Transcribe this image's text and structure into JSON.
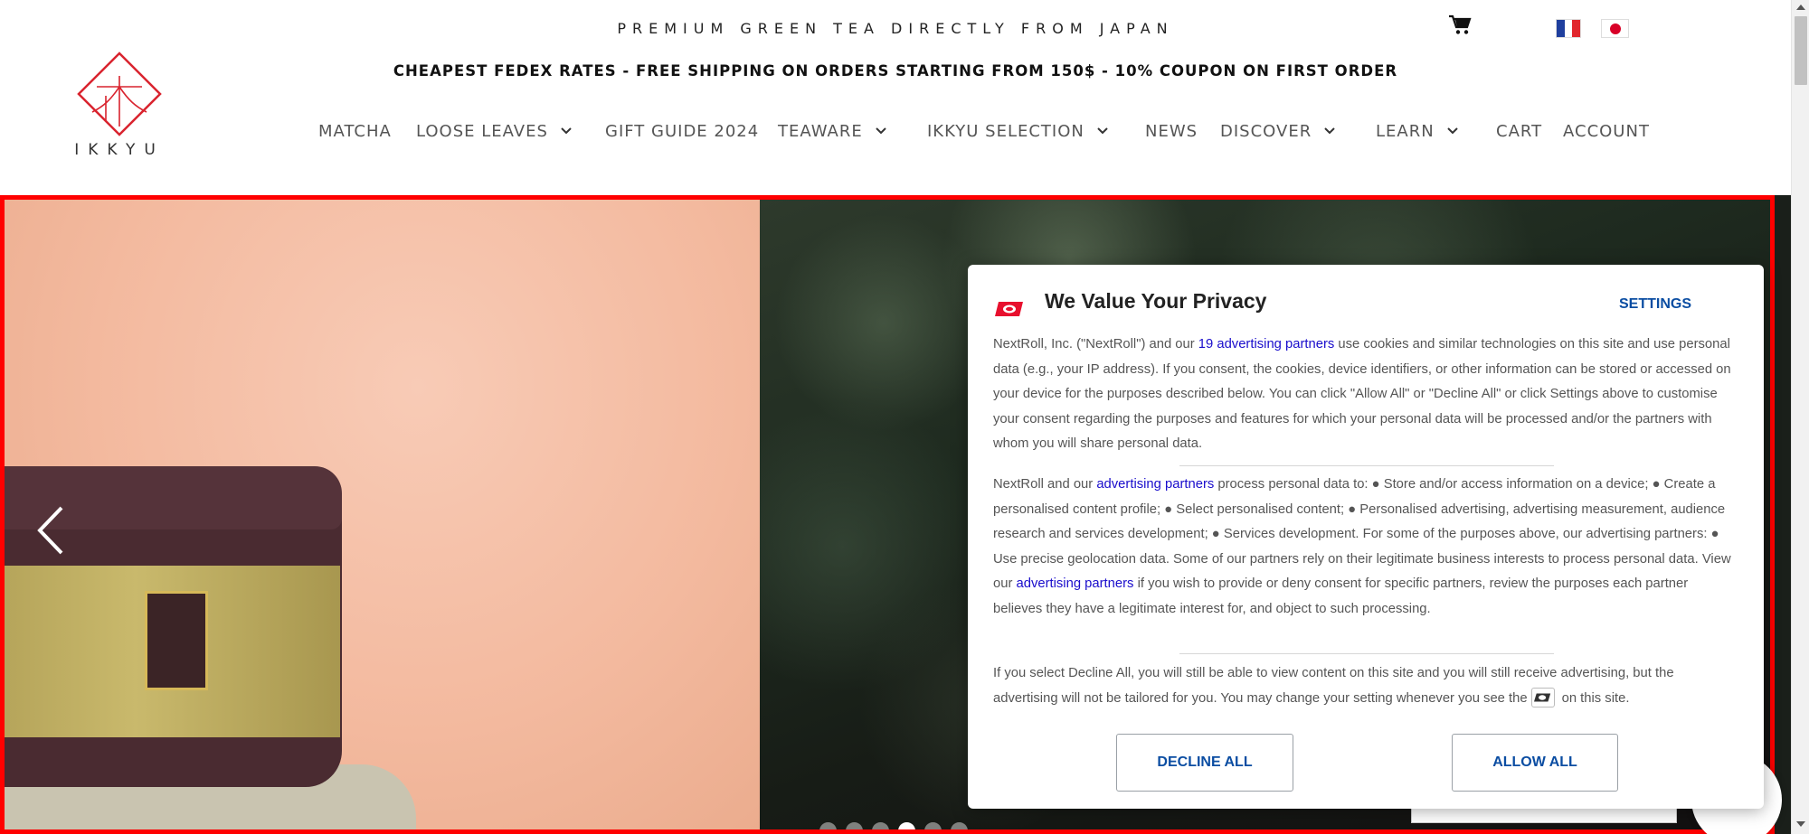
{
  "header": {
    "tagline": "PREMIUM GREEN TEA DIRECTLY FROM JAPAN",
    "promo": "CHEAPEST FEDEX RATES - FREE SHIPPING ON ORDERS STARTING FROM 150$ - 10% COUPON ON FIRST ORDER",
    "logo_text": "IKKYU",
    "cart_icon": "cart-icon",
    "languages": [
      "fr-flag-icon",
      "jp-flag-icon"
    ]
  },
  "nav": {
    "items": [
      {
        "label": "MATCHA",
        "has_dropdown": false
      },
      {
        "label": "LOOSE LEAVES",
        "has_dropdown": true
      },
      {
        "label": "GIFT GUIDE 2024",
        "has_dropdown": false
      },
      {
        "label": "TEAWARE",
        "has_dropdown": true
      },
      {
        "label": "IKKYU SELECTION",
        "has_dropdown": true
      },
      {
        "label": "NEWS",
        "has_dropdown": false
      },
      {
        "label": "DISCOVER",
        "has_dropdown": true
      },
      {
        "label": "LEARN",
        "has_dropdown": true
      },
      {
        "label": "CART",
        "has_dropdown": false
      },
      {
        "label": "ACCOUNT",
        "has_dropdown": false
      }
    ]
  },
  "hero": {
    "slide_count": 6,
    "active_slide": 4,
    "prev_icon": "chevron-left-icon"
  },
  "consent": {
    "title": "We Value Your Privacy",
    "settings_label": "SETTINGS",
    "p1_a": "NextRoll, Inc. (\"NextRoll\") and our ",
    "p1_link": "19 advertising partners",
    "p1_b": " use cookies and similar technologies on this site and use personal data (e.g., your IP address). If you consent, the cookies, device identifiers, or other information can be stored or accessed on your device for the purposes described below. You can click \"Allow All\" or \"Decline All\" or click Settings above to customise your consent regarding the purposes and features for which your personal data will be processed and/or the partners with whom you will share personal data.",
    "p2_a": "NextRoll and our ",
    "p2_link1": "advertising partners",
    "p2_b": " process personal data to: ● Store and/or access information on a device; ● Create a personalised content profile; ● Select personalised content; ● Personalised advertising, advertising measurement, audience research and services development; ● Services development. For some of the purposes above, our advertising partners: ● Use precise geolocation data. Some of our partners rely on their legitimate business interests to process personal data. View our ",
    "p2_link2": "advertising partners",
    "p2_c": " if you wish to provide or deny consent for specific partners, review the purposes each partner believes they have a legitimate interest for, and object to such processing.",
    "p3_a": "If you select Decline All, you will still be able to view content on this site and you will still receive advertising, but the advertising will not be tailored for you. You may change your setting whenever you see the",
    "p3_b": "on this site.",
    "decline_label": "DECLINE ALL",
    "allow_label": "ALLOW ALL"
  },
  "colors": {
    "accent_red": "#ff0000",
    "brand_logo_red": "#d9232e",
    "button_blue": "#0b4da2",
    "link_blue": "#1a0dcc"
  }
}
